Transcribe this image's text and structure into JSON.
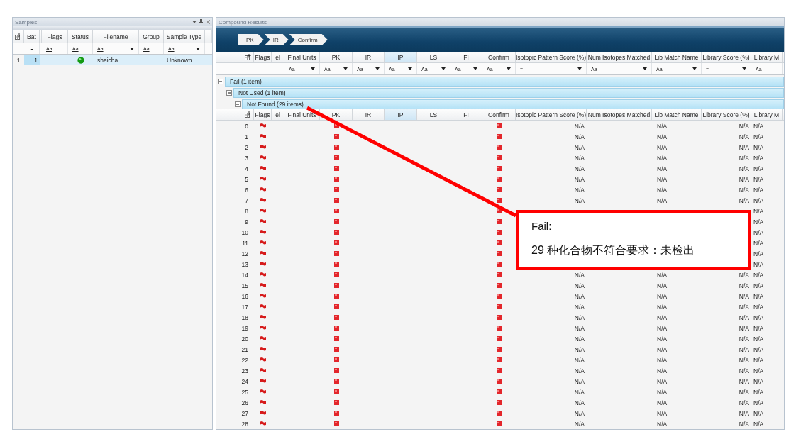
{
  "samples_panel": {
    "title": "Samples",
    "columns": [
      "Bat",
      "Flags",
      "Status",
      "Filename",
      "Group",
      "Sample Type"
    ],
    "filters": [
      {
        "text": "=",
        "dropdown": false
      },
      {
        "text": "Aa",
        "dropdown": false
      },
      {
        "text": "Aa",
        "dropdown": false
      },
      {
        "text": "Aa",
        "dropdown": true
      },
      {
        "text": "Aa",
        "dropdown": false
      },
      {
        "text": "Aa",
        "dropdown": true
      }
    ],
    "rows": [
      {
        "row_number": "1",
        "bat": "1",
        "status_ok": true,
        "filename": "shaicha",
        "sample_type": "Unknown",
        "selected": true
      }
    ]
  },
  "compound_panel": {
    "title": "Compound Results",
    "breadcrumb": [
      {
        "label": "PK"
      },
      {
        "label": "IR"
      },
      {
        "label": "Confirm"
      }
    ],
    "columns": [
      {
        "label": "Flags",
        "sorted": false
      },
      {
        "label": "el",
        "sorted": false
      },
      {
        "label": "Final Units",
        "sorted": false
      },
      {
        "label": "PK",
        "sorted": false
      },
      {
        "label": "IR",
        "sorted": false
      },
      {
        "label": "IP",
        "sorted": true
      },
      {
        "label": "LS",
        "sorted": false
      },
      {
        "label": "FI",
        "sorted": false
      },
      {
        "label": "Confirm",
        "sorted": false
      },
      {
        "label": "Isotopic Pattern Score (%)",
        "sorted": false
      },
      {
        "label": "Num Isotopes Matched",
        "sorted": false
      },
      {
        "label": "Lib Match Name",
        "sorted": false
      },
      {
        "label": "Library Score (%)",
        "sorted": false
      },
      {
        "label": "Library M",
        "sorted": false
      }
    ],
    "filters": [
      {
        "text": "Aa",
        "dropdown": true
      },
      {
        "text": "Aa",
        "dropdown": true
      },
      {
        "text": "Aa",
        "dropdown": true
      },
      {
        "text": "Aa",
        "dropdown": true
      },
      {
        "text": "Aa",
        "dropdown": true
      },
      {
        "text": "Aa",
        "dropdown": true
      },
      {
        "text": "Aa",
        "dropdown": true
      },
      {
        "text": "=",
        "dropdown": true
      },
      {
        "text": "Aa",
        "dropdown": true
      },
      {
        "text": "Aa",
        "dropdown": true
      },
      {
        "text": "=",
        "dropdown": true
      },
      {
        "text": "Aa",
        "dropdown": false
      }
    ],
    "groups": [
      {
        "label": "Fail (1 item)",
        "expanded": true,
        "children": [
          {
            "label": "Not Used (1 item)",
            "expanded": true,
            "children": [
              {
                "label": "Not Found (29 items)",
                "expanded": true,
                "columns": [
                  {
                    "label": "Flags",
                    "sorted": false
                  },
                  {
                    "label": "el",
                    "sorted": false
                  },
                  {
                    "label": "Final Units",
                    "sorted": false
                  },
                  {
                    "label": "PK",
                    "sorted": false
                  },
                  {
                    "label": "IR",
                    "sorted": false
                  },
                  {
                    "label": "IP",
                    "sorted": true
                  },
                  {
                    "label": "LS",
                    "sorted": false
                  },
                  {
                    "label": "FI",
                    "sorted": false
                  },
                  {
                    "label": "Confirm",
                    "sorted": false
                  },
                  {
                    "label": "Isotopic Pattern Score (%)",
                    "sorted": false
                  },
                  {
                    "label": "Num Isotopes Matched",
                    "sorted": false
                  },
                  {
                    "label": "Lib Match Name",
                    "sorted": false
                  },
                  {
                    "label": "Library Score (%)",
                    "sorted": false
                  },
                  {
                    "label": "Library M",
                    "sorted": false
                  }
                ],
                "rows": [
                  {
                    "index": "0",
                    "flagged": true,
                    "pk_fail": true,
                    "confirm_fail": true,
                    "isotopic_pattern_score": "N/A",
                    "lib_match_name": "N/A",
                    "library_score": "N/A",
                    "library_m": "N/A"
                  },
                  {
                    "index": "1",
                    "flagged": true,
                    "pk_fail": true,
                    "confirm_fail": true,
                    "isotopic_pattern_score": "N/A",
                    "lib_match_name": "N/A",
                    "library_score": "N/A",
                    "library_m": "N/A"
                  },
                  {
                    "index": "2",
                    "flagged": true,
                    "pk_fail": true,
                    "confirm_fail": true,
                    "isotopic_pattern_score": "N/A",
                    "lib_match_name": "N/A",
                    "library_score": "N/A",
                    "library_m": "N/A"
                  },
                  {
                    "index": "3",
                    "flagged": true,
                    "pk_fail": true,
                    "confirm_fail": true,
                    "isotopic_pattern_score": "N/A",
                    "lib_match_name": "N/A",
                    "library_score": "N/A",
                    "library_m": "N/A"
                  },
                  {
                    "index": "4",
                    "flagged": true,
                    "pk_fail": true,
                    "confirm_fail": true,
                    "isotopic_pattern_score": "N/A",
                    "lib_match_name": "N/A",
                    "library_score": "N/A",
                    "library_m": "N/A"
                  },
                  {
                    "index": "5",
                    "flagged": true,
                    "pk_fail": true,
                    "confirm_fail": true,
                    "isotopic_pattern_score": "N/A",
                    "lib_match_name": "N/A",
                    "library_score": "N/A",
                    "library_m": "N/A"
                  },
                  {
                    "index": "6",
                    "flagged": true,
                    "pk_fail": true,
                    "confirm_fail": true,
                    "isotopic_pattern_score": "N/A",
                    "lib_match_name": "N/A",
                    "library_score": "N/A",
                    "library_m": "N/A"
                  },
                  {
                    "index": "7",
                    "flagged": true,
                    "pk_fail": true,
                    "confirm_fail": true,
                    "isotopic_pattern_score": "N/A",
                    "lib_match_name": "N/A",
                    "library_score": "N/A",
                    "library_m": "N/A"
                  },
                  {
                    "index": "8",
                    "flagged": true,
                    "pk_fail": true,
                    "confirm_fail": true,
                    "library_m": "N/A"
                  },
                  {
                    "index": "9",
                    "flagged": true,
                    "pk_fail": true,
                    "confirm_fail": true,
                    "library_m": "N/A"
                  },
                  {
                    "index": "10",
                    "flagged": true,
                    "pk_fail": true,
                    "confirm_fail": true,
                    "library_m": "N/A"
                  },
                  {
                    "index": "11",
                    "flagged": true,
                    "pk_fail": true,
                    "confirm_fail": true,
                    "library_m": "N/A"
                  },
                  {
                    "index": "12",
                    "flagged": true,
                    "pk_fail": true,
                    "confirm_fail": true,
                    "library_m": "N/A"
                  },
                  {
                    "index": "13",
                    "flagged": true,
                    "pk_fail": true,
                    "confirm_fail": true,
                    "library_m": "N/A"
                  },
                  {
                    "index": "14",
                    "flagged": true,
                    "pk_fail": true,
                    "confirm_fail": true,
                    "isotopic_pattern_score": "N/A",
                    "lib_match_name": "N/A",
                    "library_score": "N/A",
                    "library_m": "N/A"
                  },
                  {
                    "index": "15",
                    "flagged": true,
                    "pk_fail": true,
                    "confirm_fail": true,
                    "isotopic_pattern_score": "N/A",
                    "lib_match_name": "N/A",
                    "library_score": "N/A",
                    "library_m": "N/A"
                  },
                  {
                    "index": "16",
                    "flagged": true,
                    "pk_fail": true,
                    "confirm_fail": true,
                    "isotopic_pattern_score": "N/A",
                    "lib_match_name": "N/A",
                    "library_score": "N/A",
                    "library_m": "N/A"
                  },
                  {
                    "index": "17",
                    "flagged": true,
                    "pk_fail": true,
                    "confirm_fail": true,
                    "isotopic_pattern_score": "N/A",
                    "lib_match_name": "N/A",
                    "library_score": "N/A",
                    "library_m": "N/A"
                  },
                  {
                    "index": "18",
                    "flagged": true,
                    "pk_fail": true,
                    "confirm_fail": true,
                    "isotopic_pattern_score": "N/A",
                    "lib_match_name": "N/A",
                    "library_score": "N/A",
                    "library_m": "N/A"
                  },
                  {
                    "index": "19",
                    "flagged": true,
                    "pk_fail": true,
                    "confirm_fail": true,
                    "isotopic_pattern_score": "N/A",
                    "lib_match_name": "N/A",
                    "library_score": "N/A",
                    "library_m": "N/A"
                  },
                  {
                    "index": "20",
                    "flagged": true,
                    "pk_fail": true,
                    "confirm_fail": true,
                    "isotopic_pattern_score": "N/A",
                    "lib_match_name": "N/A",
                    "library_score": "N/A",
                    "library_m": "N/A"
                  },
                  {
                    "index": "21",
                    "flagged": true,
                    "pk_fail": true,
                    "confirm_fail": true,
                    "isotopic_pattern_score": "N/A",
                    "lib_match_name": "N/A",
                    "library_score": "N/A",
                    "library_m": "N/A"
                  },
                  {
                    "index": "22",
                    "flagged": true,
                    "pk_fail": true,
                    "confirm_fail": true,
                    "isotopic_pattern_score": "N/A",
                    "lib_match_name": "N/A",
                    "library_score": "N/A",
                    "library_m": "N/A"
                  },
                  {
                    "index": "23",
                    "flagged": true,
                    "pk_fail": true,
                    "confirm_fail": true,
                    "isotopic_pattern_score": "N/A",
                    "lib_match_name": "N/A",
                    "library_score": "N/A",
                    "library_m": "N/A"
                  },
                  {
                    "index": "24",
                    "flagged": true,
                    "pk_fail": true,
                    "confirm_fail": true,
                    "isotopic_pattern_score": "N/A",
                    "lib_match_name": "N/A",
                    "library_score": "N/A",
                    "library_m": "N/A"
                  },
                  {
                    "index": "25",
                    "flagged": true,
                    "pk_fail": true,
                    "confirm_fail": true,
                    "isotopic_pattern_score": "N/A",
                    "lib_match_name": "N/A",
                    "library_score": "N/A",
                    "library_m": "N/A"
                  },
                  {
                    "index": "26",
                    "flagged": true,
                    "pk_fail": true,
                    "confirm_fail": true,
                    "isotopic_pattern_score": "N/A",
                    "lib_match_name": "N/A",
                    "library_score": "N/A",
                    "library_m": "N/A"
                  },
                  {
                    "index": "27",
                    "flagged": true,
                    "pk_fail": true,
                    "confirm_fail": true,
                    "isotopic_pattern_score": "N/A",
                    "lib_match_name": "N/A",
                    "library_score": "N/A",
                    "library_m": "N/A"
                  },
                  {
                    "index": "28",
                    "flagged": true,
                    "pk_fail": true,
                    "confirm_fail": true,
                    "isotopic_pattern_score": "N/A",
                    "lib_match_name": "N/A",
                    "library_score": "N/A",
                    "library_m": "N/A"
                  }
                ]
              }
            ]
          }
        ]
      }
    ]
  },
  "annotation": {
    "title": "Fail:",
    "text": "29 种化合物不符合要求：未检出"
  }
}
